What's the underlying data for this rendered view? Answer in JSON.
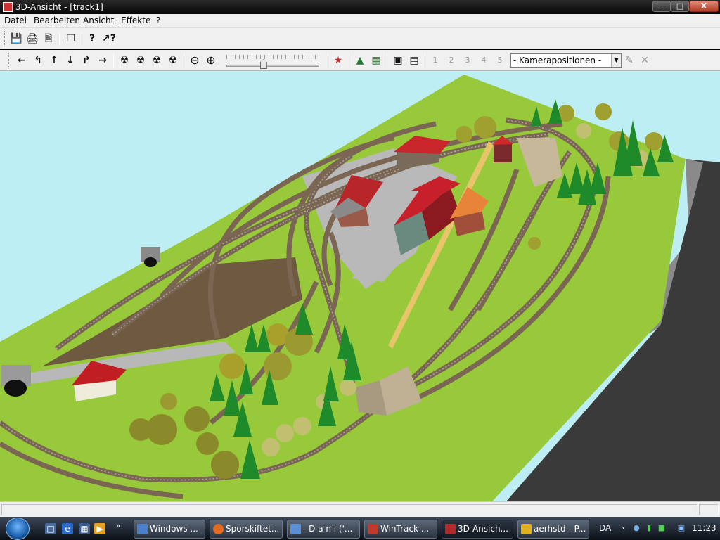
{
  "window": {
    "title": "3D-Ansicht - [track1]",
    "min": "−",
    "max": "□",
    "close": "X"
  },
  "menu": {
    "items": [
      "Datei",
      "Bearbeiten",
      "Ansicht",
      "Effekte",
      "?"
    ]
  },
  "toolbar1": {
    "icons": {
      "save": "💾",
      "print": "🖨",
      "preview": "🖹",
      "copy": "❐",
      "help": "?",
      "context_help": "↗?"
    }
  },
  "toolbar2": {
    "nav": {
      "left": "←",
      "turn_left": "↰",
      "up": "↑",
      "down": "↓",
      "turn_right": "↱",
      "right": "→"
    },
    "camera": {
      "tilt1": "☢",
      "tilt2": "☢",
      "tilt3": "☢",
      "tilt4": "☢"
    },
    "zoom": {
      "out": "⊖",
      "in": "⊕"
    },
    "slider": {
      "value": 0.4
    },
    "tools": {
      "signal": "★",
      "bridge": "▲",
      "grid": "▦",
      "frame": "▣",
      "camera": "▤"
    },
    "cam_positions": [
      "1",
      "2",
      "3",
      "4",
      "5"
    ],
    "camera_select": "- Kamerapositionen -",
    "pen": "✎",
    "clear": "✕"
  },
  "taskbar": {
    "buttons": [
      {
        "label": "Windows ...",
        "color": "#4a7fc9"
      },
      {
        "label": "Sporskiftet...",
        "color": "#e36a1e"
      },
      {
        "label": "- D a n i ('...",
        "color": "#5a8fd4"
      },
      {
        "label": "WinTrack ...",
        "color": "#c0392b"
      },
      {
        "label": "3D-Ansich...",
        "color": "#b02a2a",
        "active": true
      },
      {
        "label": "aerhstd - P...",
        "color": "#e0b020"
      }
    ],
    "language": "DA",
    "clock": "11:23"
  }
}
